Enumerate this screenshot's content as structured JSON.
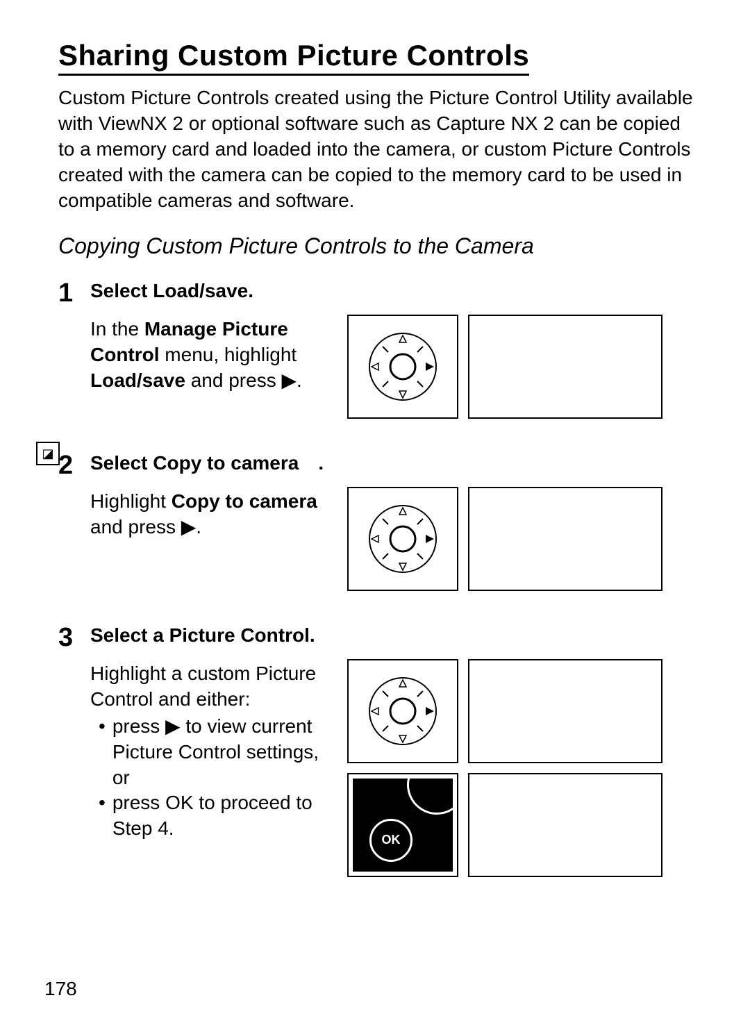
{
  "title": "Sharing Custom Picture Controls",
  "intro": "Custom Picture Controls created using the Picture Control Utility available with ViewNX 2 or optional software such as Capture NX 2 can be copied to a memory card and loaded into the camera, or custom Picture Controls created with the camera can be copied to the memory card to be used in compatible cameras and software.",
  "subtitle": "Copying Custom Picture Controls to the Camera",
  "steps": {
    "s1": {
      "num": "1",
      "heading": "Select Load/save.",
      "desc_pre": "In the ",
      "desc_bold1": "Manage Picture Control",
      "desc_mid": " menu, highlight ",
      "desc_bold2": "Load/save",
      "desc_post": " and press ▶."
    },
    "s2": {
      "num": "2",
      "heading_pre": "Select Copy to camera",
      "heading_post": ".",
      "desc_pre": "Highlight ",
      "desc_bold": "Copy to camera",
      "desc_post": " and press ▶."
    },
    "s3": {
      "num": "3",
      "heading": "Select a Picture Control.",
      "line1": "Highlight a custom Picture Control and either:",
      "bullet1": "press ▶ to view current Picture Control settings, or",
      "bullet2_pre": "press ",
      "bullet2_ok": "OK",
      "bullet2_post": " to proceed to Step 4."
    }
  },
  "tab_icon": "◪",
  "ok_label": "OK",
  "page_number": "178"
}
